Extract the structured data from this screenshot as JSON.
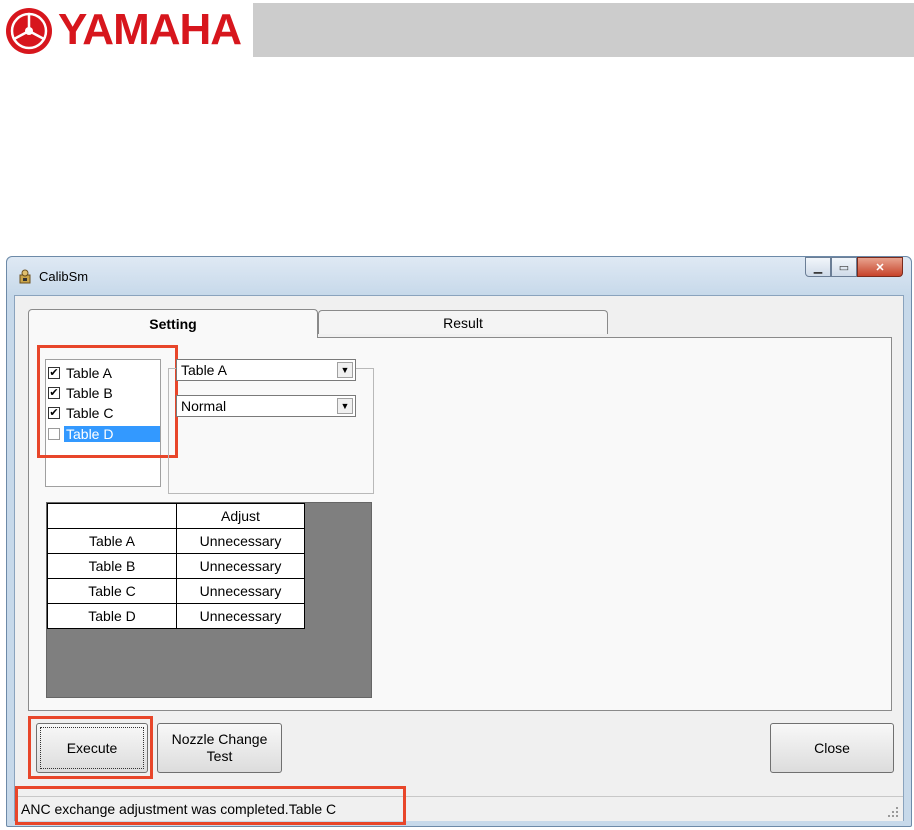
{
  "brand": {
    "logo_text": "YAMAHA",
    "color": "#d7161d"
  },
  "window": {
    "title": "CalibSm",
    "buttons": [
      "minimize",
      "maximize",
      "close"
    ]
  },
  "tabs": [
    {
      "label": "Setting",
      "active": true
    },
    {
      "label": "Result",
      "active": false
    }
  ],
  "checklist": {
    "items": [
      {
        "label": "Table A",
        "checked": true,
        "selected": false
      },
      {
        "label": "Table B",
        "checked": true,
        "selected": false
      },
      {
        "label": "Table C",
        "checked": true,
        "selected": false
      },
      {
        "label": "Table D",
        "checked": false,
        "selected": true
      }
    ]
  },
  "combos": {
    "table_value": "Table A",
    "mode_value": "Normal"
  },
  "grid": {
    "columns": [
      "",
      "Adjust"
    ],
    "rows": [
      [
        "Table A",
        "Unnecessary"
      ],
      [
        "Table B",
        "Unnecessary"
      ],
      [
        "Table C",
        "Unnecessary"
      ],
      [
        "Table D",
        "Unnecessary"
      ]
    ]
  },
  "buttons": {
    "execute": "Execute",
    "nozzle_line1": "Nozzle Change",
    "nozzle_line2": "Test",
    "close": "Close"
  },
  "status": {
    "message": "ANC exchange adjustment was completed.Table C"
  },
  "highlight_color": "#e8462a"
}
